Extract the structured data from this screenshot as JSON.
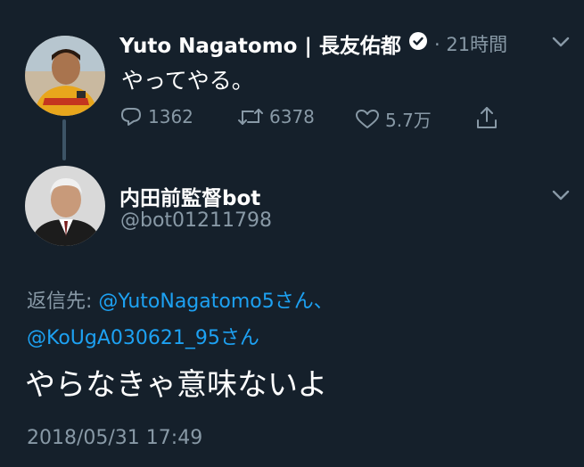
{
  "tweet": {
    "author_name": "Yuto Nagatomo | 長友佑都",
    "time": "· 21時間",
    "text": "やってやる。",
    "actions": {
      "replies": "1362",
      "retweets": "6378",
      "likes": "5.7万"
    }
  },
  "reply": {
    "author_name": "内田前監督bot",
    "handle": "@bot01211798",
    "reply_to_label": "返信先:",
    "reply_to_1": "@YutoNagatomo5さん、",
    "reply_to_2": "@KoUgA030621_95さん",
    "text": "やらなきゃ意味ないよ",
    "timestamp": "2018/05/31 17:49"
  },
  "colors": {
    "background": "#15202b",
    "secondary_text": "#8899a6",
    "link": "#1da1f2",
    "thread_line": "#3d5466"
  },
  "icons": [
    "reply-icon",
    "retweet-icon",
    "like-icon",
    "share-icon",
    "verified-icon",
    "chevron-down-icon"
  ]
}
